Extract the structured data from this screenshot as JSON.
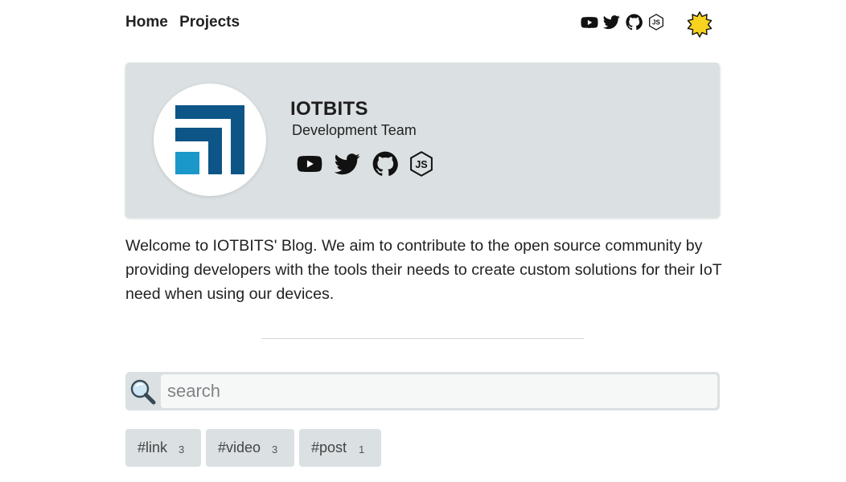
{
  "nav": {
    "links": [
      "Home",
      "Projects"
    ],
    "icons": [
      "youtube-icon",
      "twitter-icon",
      "github-icon",
      "nodejs-icon"
    ],
    "theme_toggle_icon": "sun-icon"
  },
  "profile": {
    "name": "IOTBITS",
    "subtitle": "Development Team",
    "icons": [
      "youtube-icon",
      "twitter-icon",
      "github-icon",
      "nodejs-icon"
    ]
  },
  "welcome": {
    "text": "Welcome to IOTBITS' Blog. We aim to contribute to the open source community by providing developers with the tools their needs to create custom solutions for their IoT need when using our devices."
  },
  "search": {
    "placeholder": "search",
    "value": ""
  },
  "tags": [
    {
      "label": "#link",
      "count": "3"
    },
    {
      "label": "#video",
      "count": "3"
    },
    {
      "label": "#post",
      "count": "1"
    }
  ],
  "colors": {
    "card_bg": "#dbe0e2",
    "logo_dark_blue": "#0e5587",
    "logo_light_blue": "#1a98c9",
    "sun": "#f7d21e",
    "text": "#222222"
  }
}
